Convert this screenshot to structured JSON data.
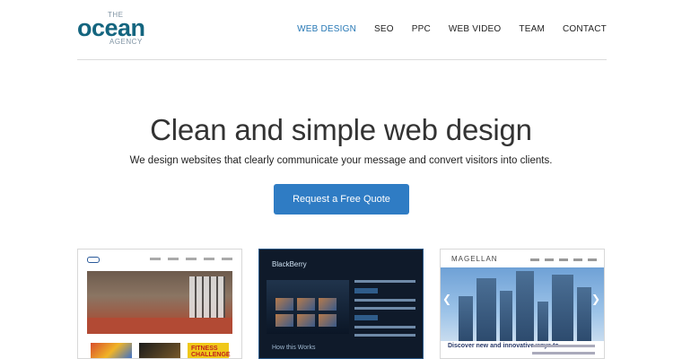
{
  "logo": {
    "the": "THE",
    "ocean": "ocean",
    "agency": "AGENCY"
  },
  "nav": {
    "items": [
      "WEB DESIGN",
      "SEO",
      "PPC",
      "WEB VIDEO",
      "TEAM",
      "CONTACT"
    ],
    "active": "WEB DESIGN"
  },
  "hero": {
    "title": "Clean and simple web design",
    "subtitle": "We design websites that clearly communicate your message and convert visitors into clients.",
    "cta_label": "Request a Free Quote"
  },
  "portfolio": {
    "thumb1": {
      "tile_label": "FITNESS CHALLENGE"
    },
    "thumb2": {
      "brand": "BlackBerry",
      "section": "How this Works"
    },
    "thumb3": {
      "brand": "MAGELLAN",
      "headline": "Discover new and innovative ways to"
    }
  },
  "colors": {
    "accent": "#2f7cc4",
    "nav_active": "#2778b5",
    "logo": "#14657f"
  }
}
